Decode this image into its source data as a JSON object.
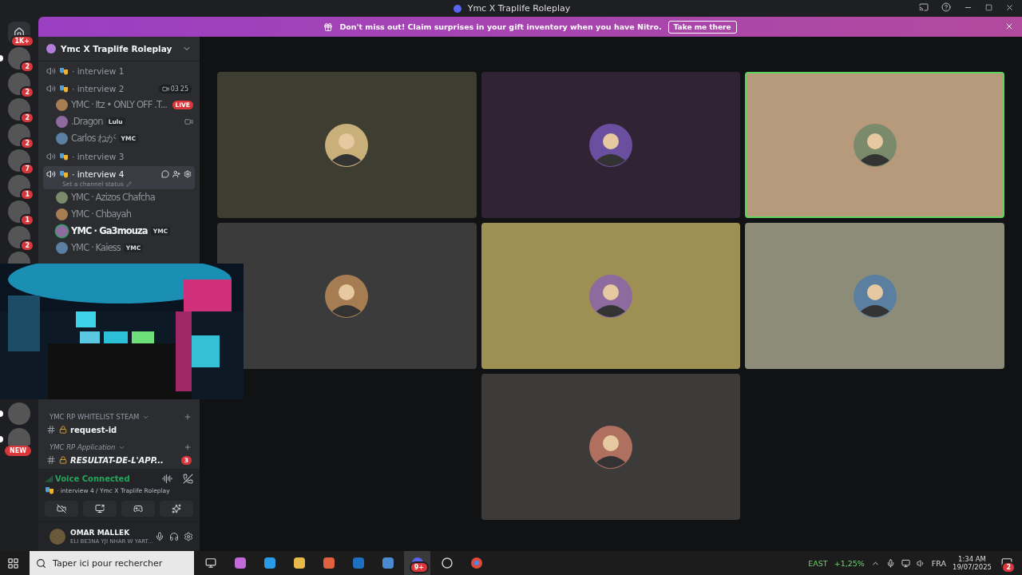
{
  "window": {
    "title": "Ymc X Traplife Roleplay"
  },
  "banner": {
    "text": "Don't miss out! Claim surprises in your gift inventory when you have Nitro.",
    "button": "Take me there"
  },
  "servers_top": [
    {
      "kind": "home",
      "badge": "1K+",
      "unread": false
    },
    {
      "kind": "server",
      "badge": "2",
      "unread": true
    },
    {
      "kind": "server",
      "badge": "2",
      "unread": false
    },
    {
      "kind": "server",
      "badge": "2",
      "unread": false
    },
    {
      "kind": "server",
      "badge": "2",
      "unread": false
    },
    {
      "kind": "server",
      "badge": "7",
      "unread": false
    },
    {
      "kind": "server",
      "badge": "1",
      "unread": false
    },
    {
      "kind": "server",
      "badge": "1",
      "unread": false
    },
    {
      "kind": "server",
      "badge": "2",
      "unread": false
    },
    {
      "kind": "server",
      "unread": false
    }
  ],
  "servers_bottom": [
    {
      "kind": "server",
      "unread": true
    },
    {
      "kind": "new",
      "badge": "NEW",
      "unread": true
    }
  ],
  "server_name": "Ymc X Traplife Roleplay",
  "voice_channels": [
    {
      "name": "· interview 1",
      "selected": false
    },
    {
      "name": "· interview 2",
      "selected": false,
      "video_count": "03",
      "user_count": "25",
      "users": [
        {
          "name": "YMC · Itz • ONLY OFF .T...",
          "badge": "LIVE",
          "camera": false,
          "speaking": false
        },
        {
          "name": ".Dragon",
          "tag": "Lulu",
          "camera": true,
          "speaking": false
        },
        {
          "name": "Carlos ねが",
          "tag": "YMC",
          "camera": false,
          "speaking": false
        }
      ]
    },
    {
      "name": "· interview 3",
      "selected": false
    },
    {
      "name": "· interview 4",
      "selected": true,
      "status": "Set a channel status",
      "users": [
        {
          "name": "YMC · Azizos Chafcha",
          "camera": false,
          "speaking": false
        },
        {
          "name": "YMC · Chbayah",
          "camera": false,
          "speaking": false
        },
        {
          "name": "YMC · Ga3mouza",
          "tag": "YMC",
          "camera": false,
          "speaking": true
        },
        {
          "name": "YMC · Kaiess",
          "tag": "YMC",
          "camera": false,
          "speaking": false
        }
      ]
    }
  ],
  "lower_channels": [
    {
      "kind": "category",
      "name": "YMC RP WHITELIST STEAM",
      "italic": false
    },
    {
      "kind": "channel",
      "name": "request-id",
      "italic": false
    },
    {
      "kind": "category",
      "name": "YMC RP Application",
      "italic": true
    },
    {
      "kind": "channel",
      "name": "RESULTAT-DE-L'APP...",
      "italic": true,
      "badge": "3"
    }
  ],
  "voice_panel": {
    "status": "Voice Connected",
    "channel": "· interview 4 / Ymc X Traplife Roleplay"
  },
  "user_panel": {
    "name": "OMAR MALLEK",
    "custom_status": "ELI BE3NA YJI NHAR W YART..."
  },
  "tiles": [
    {
      "color": "#3e3d31",
      "speaking": false
    },
    {
      "color": "#2f2334",
      "speaking": false
    },
    {
      "color": "#b69a7b",
      "speaking": true
    },
    {
      "color": "#3b3b3b",
      "speaking": false
    },
    {
      "color": "#9e8f53",
      "speaking": false
    },
    {
      "color": "#8d8c79",
      "speaking": false
    },
    {
      "color": "#3d3a3a",
      "speaking": false
    }
  ],
  "taskbar": {
    "search_placeholder": "Taper ici pour rechercher",
    "discord_badge": "9+",
    "stock_name": "EAST",
    "stock_change": "+1,25%",
    "language": "FRA",
    "time": "1:34 AM",
    "date": "19/07/2025",
    "notifications": "2"
  }
}
